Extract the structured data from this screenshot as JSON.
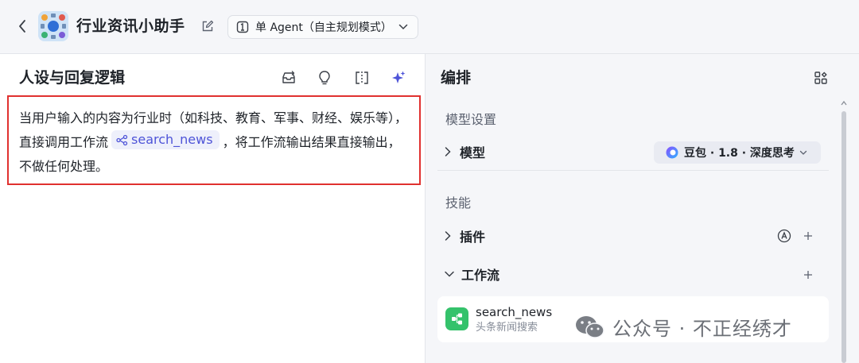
{
  "header": {
    "back_icon": "chevron-left-icon",
    "app_title": "行业资讯小助手",
    "edit_icon": "edit-icon",
    "mode": "单 Agent（自主规划模式）",
    "mode_icon": "agent-mode-icon"
  },
  "persona": {
    "title": "人设与回复逻辑",
    "tools": [
      "inbox-icon",
      "lightbulb-icon",
      "split-view-icon",
      "sparkle-icon"
    ],
    "text_before": "当用户输入的内容为行业时（如科技、教育、军事、财经、娱乐等），直接调用工作流",
    "tag_label": "search_news",
    "text_after": "，将工作流输出结果直接输出，不做任何处理。"
  },
  "arrangement": {
    "title": "编排",
    "layout_icon": "grid-layout-icon",
    "model_settings": {
      "label": "模型设置",
      "model_row_label": "模型",
      "model_value": "豆包 · 1.8 · 深度思考"
    },
    "skills": {
      "label": "技能",
      "plugins_label": "插件",
      "workflow_label": "工作流",
      "workflow_item": {
        "name": "search_news",
        "description": "头条新闻搜索"
      }
    }
  },
  "watermark": {
    "text": "公众号 · 不正经绣才"
  },
  "colors": {
    "highlight_border": "#e0312f",
    "tag_text": "#4e54d8",
    "workflow_green": "#34c26b"
  }
}
